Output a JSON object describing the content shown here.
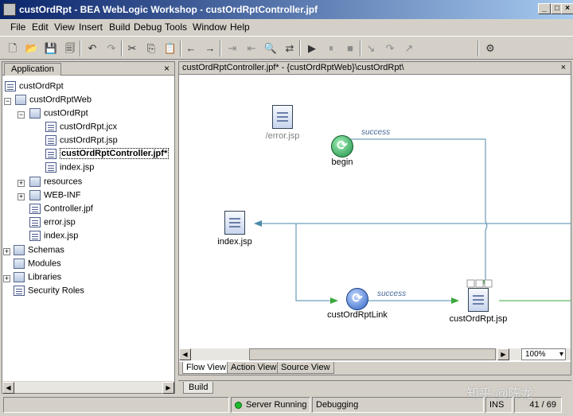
{
  "window": {
    "title": "custOrdRpt - BEA WebLogic Workshop - custOrdRptController.jpf",
    "min_btn": "_",
    "max_btn": "□",
    "close_btn": "×"
  },
  "menu": [
    "File",
    "Edit",
    "View",
    "Insert",
    "Build",
    "Debug",
    "Tools",
    "Window",
    "Help"
  ],
  "toolbar_glyphs": {
    "new": "🗋",
    "open": "📂",
    "save": "💾",
    "saveall": "🗐",
    "undo": "↶",
    "redo": "↷",
    "cut": "✂",
    "copy": "⎘",
    "paste": "📋",
    "back": "←",
    "forward": "→",
    "indent": "⇥",
    "outdent": "⇤",
    "find": "🔍",
    "replace": "⇄",
    "start": "▶",
    "pause": "⏸",
    "stop": "■",
    "step_into": "↘",
    "step_over": "↷",
    "step_out": "↗",
    "test": "⚙"
  },
  "application_panel": {
    "tab": "Application",
    "close": "×",
    "tree": [
      {
        "label": "custOrdRpt"
      },
      {
        "label": "custOrdRptWeb",
        "expander": "−"
      },
      {
        "label": "custOrdRpt",
        "expander": "−"
      },
      {
        "label": "custOrdRpt.jcx"
      },
      {
        "label": "custOrdRpt.jsp"
      },
      {
        "label": "custOrdRptController.jpf*"
      },
      {
        "label": "index.jsp"
      },
      {
        "label": "resources",
        "expander": "+"
      },
      {
        "label": "WEB-INF",
        "expander": "+"
      },
      {
        "label": "Controller.jpf"
      },
      {
        "label": "error.jsp"
      },
      {
        "label": "index.jsp"
      },
      {
        "label": "Schemas",
        "expander": "+"
      },
      {
        "label": "Modules"
      },
      {
        "label": "Libraries",
        "expander": "+"
      },
      {
        "label": "Security Roles"
      }
    ]
  },
  "editor": {
    "tab_title": "custOrdRptController.jpf* - {custOrdRptWeb}\\custOrdRpt\\",
    "close": "×",
    "nodes": {
      "error": "/error.jsp",
      "begin": "begin",
      "index": "index.jsp",
      "link": "custOrdRptLink",
      "rptjsp": "custOrdRpt.jsp"
    },
    "connections": {
      "begin_success": "success",
      "link_success": "success"
    },
    "zoom": "100%",
    "zoom_arrow": "▾",
    "view_tabs": [
      "Flow View",
      "Action View",
      "Source View"
    ]
  },
  "build_tab": "Build",
  "status": {
    "server": "Server Running",
    "mode": "Debugging",
    "ins": "INS",
    "position": "41 / 69"
  },
  "watermark": "知乎 @陈龙",
  "colors": {
    "titlebar_start": "#0a246a",
    "titlebar_end": "#a6caf0",
    "chrome": "#d4d0c8",
    "connector": "#4a8aa8",
    "arrow_green": "#3aa83a",
    "server_running": "#1dbb2e"
  }
}
